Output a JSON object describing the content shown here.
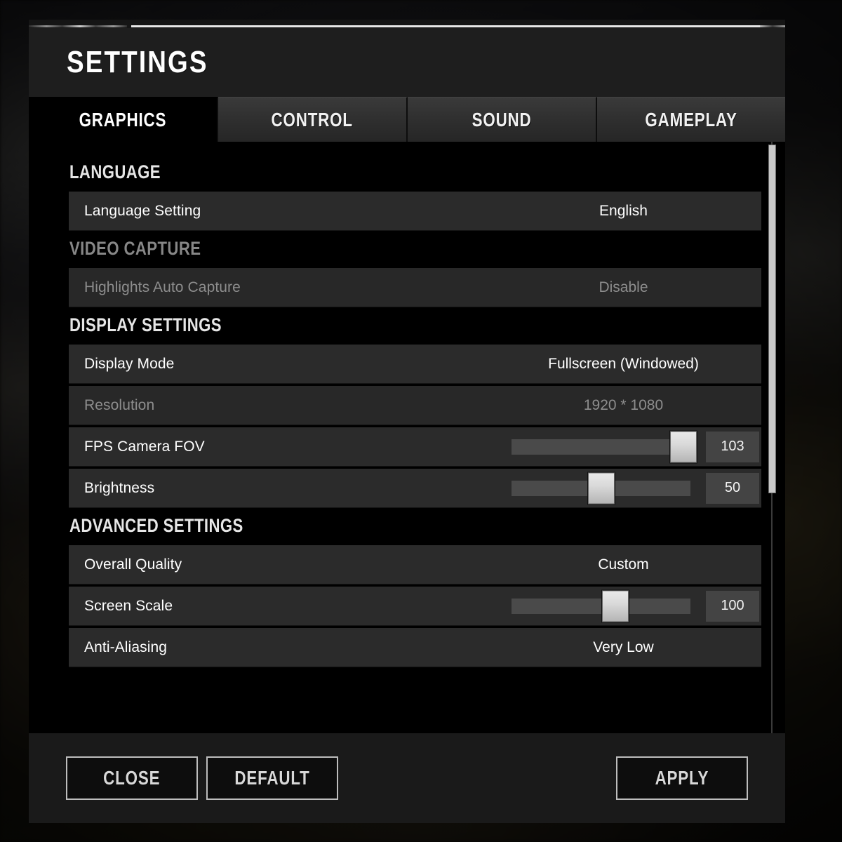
{
  "window": {
    "title": "SETTINGS"
  },
  "tabs": [
    {
      "label": "GRAPHICS",
      "active": true
    },
    {
      "label": "CONTROL",
      "active": false
    },
    {
      "label": "SOUND",
      "active": false
    },
    {
      "label": "GAMEPLAY",
      "active": false
    }
  ],
  "sections": [
    {
      "title": "LANGUAGE",
      "dim": false,
      "rows": [
        {
          "label": "Language Setting",
          "value": "English",
          "type": "value",
          "disabled": false
        }
      ]
    },
    {
      "title": "VIDEO CAPTURE",
      "dim": true,
      "rows": [
        {
          "label": "Highlights Auto Capture",
          "value": "Disable",
          "type": "value",
          "disabled": true
        }
      ]
    },
    {
      "title": "DISPLAY SETTINGS",
      "dim": false,
      "rows": [
        {
          "label": "Display Mode",
          "value": "Fullscreen (Windowed)",
          "type": "value",
          "disabled": false
        },
        {
          "label": "Resolution",
          "value": "1920 * 1080",
          "type": "value",
          "disabled": true
        },
        {
          "label": "FPS Camera FOV",
          "value": "103",
          "type": "slider",
          "percent": 96,
          "disabled": false
        },
        {
          "label": "Brightness",
          "value": "50",
          "type": "slider",
          "percent": 50,
          "disabled": false
        }
      ]
    },
    {
      "title": "ADVANCED SETTINGS",
      "dim": false,
      "rows": [
        {
          "label": "Overall Quality",
          "value": "Custom",
          "type": "value",
          "disabled": false
        },
        {
          "label": "Screen Scale",
          "value": "100",
          "type": "slider",
          "percent": 58,
          "disabled": false
        },
        {
          "label": "Anti-Aliasing",
          "value": "Very Low",
          "type": "value",
          "disabled": false
        }
      ]
    }
  ],
  "footer": {
    "close_label": "CLOSE",
    "default_label": "DEFAULT",
    "apply_label": "APPLY"
  },
  "colors": {
    "dialog_bg": "#000000",
    "header_bg": "#1e1e1e",
    "row_bg": "#2b2b2b",
    "footer_bg": "#1a1a1a",
    "text": "#ffffff",
    "text_disabled": "#8d8d8d",
    "knob": "#d9d9d9",
    "track": "#4a4a4a",
    "scrollbar": "#c9c9c9"
  }
}
